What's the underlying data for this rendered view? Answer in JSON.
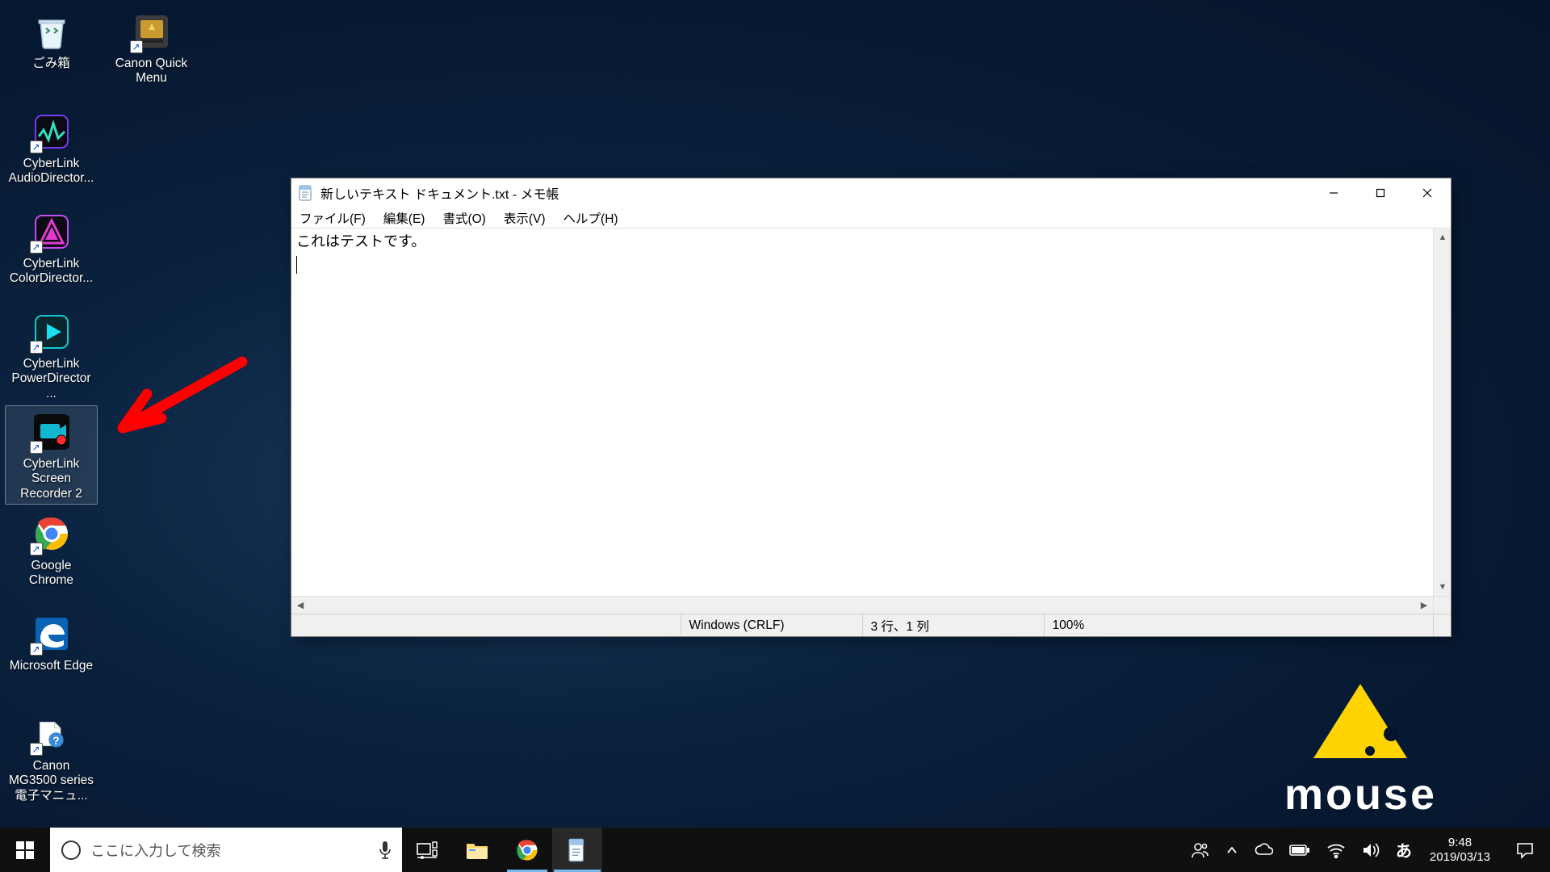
{
  "desktop": {
    "icons": [
      {
        "name": "ごみ箱"
      },
      {
        "name": "Canon Quick Menu"
      },
      {
        "name": "CyberLink AudioDirector..."
      },
      {
        "name": "CyberLink ColorDirector..."
      },
      {
        "name": "CyberLink PowerDirector ..."
      },
      {
        "name": "CyberLink Screen Recorder 2"
      },
      {
        "name": "Google Chrome"
      },
      {
        "name": "Microsoft Edge"
      },
      {
        "name": "Canon MG3500 series 電子マニュ..."
      }
    ]
  },
  "notepad": {
    "title": "新しいテキスト ドキュメント.txt - メモ帳",
    "menus": {
      "file": "ファイル(F)",
      "edit": "編集(E)",
      "format": "書式(O)",
      "view": "表示(V)",
      "help": "ヘルプ(H)"
    },
    "text_line1": "これはテストです。",
    "status": {
      "encoding": "Windows (CRLF)",
      "cursor": "3 行、1 列",
      "zoom": "100%"
    }
  },
  "brand": {
    "wordmark": "mouse"
  },
  "taskbar": {
    "search_placeholder": "ここに入力して検索",
    "ime": "あ",
    "time": "9:48",
    "date": "2019/03/13"
  }
}
